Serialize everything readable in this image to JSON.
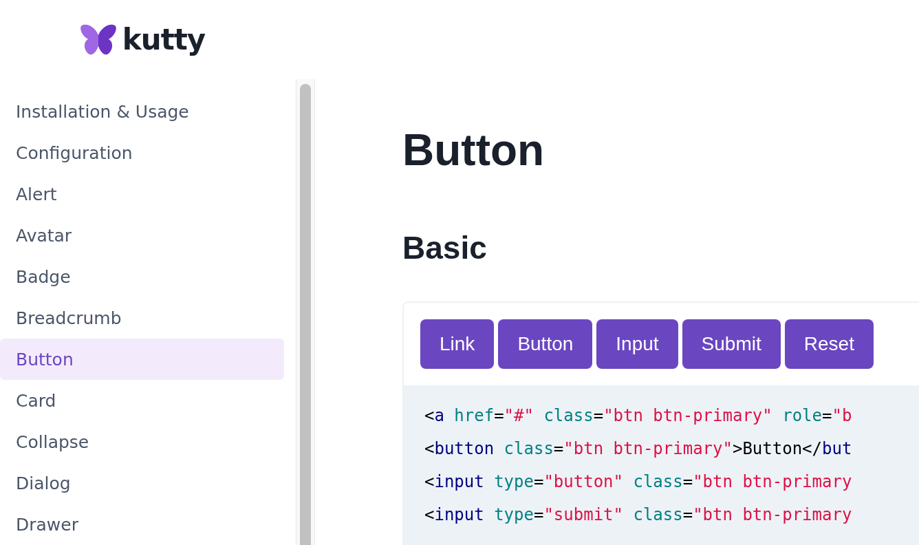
{
  "logo": {
    "name": "kutty"
  },
  "sidebar": {
    "items": [
      {
        "label": "Installation & Usage",
        "selected": false
      },
      {
        "label": "Configuration",
        "selected": false
      },
      {
        "label": "Alert",
        "selected": false
      },
      {
        "label": "Avatar",
        "selected": false
      },
      {
        "label": "Badge",
        "selected": false
      },
      {
        "label": "Breadcrumb",
        "selected": false
      },
      {
        "label": "Button",
        "selected": true
      },
      {
        "label": "Card",
        "selected": false
      },
      {
        "label": "Collapse",
        "selected": false
      },
      {
        "label": "Dialog",
        "selected": false
      },
      {
        "label": "Drawer",
        "selected": false
      }
    ]
  },
  "page": {
    "title": "Button",
    "section": "Basic"
  },
  "example": {
    "buttons": [
      "Link",
      "Button",
      "Input",
      "Submit",
      "Reset"
    ],
    "code_lines": [
      [
        {
          "kind": "punct",
          "text": "<"
        },
        {
          "kind": "tag",
          "text": "a"
        },
        {
          "kind": "attr",
          "text": " href"
        },
        {
          "kind": "punct",
          "text": "="
        },
        {
          "kind": "string",
          "text": "\"#\""
        },
        {
          "kind": "attr",
          "text": " class"
        },
        {
          "kind": "punct",
          "text": "="
        },
        {
          "kind": "string",
          "text": "\"btn btn-primary\""
        },
        {
          "kind": "attr",
          "text": " role"
        },
        {
          "kind": "punct",
          "text": "="
        },
        {
          "kind": "string",
          "text": "\"b"
        }
      ],
      [
        {
          "kind": "punct",
          "text": "<"
        },
        {
          "kind": "tag",
          "text": "button"
        },
        {
          "kind": "attr",
          "text": " class"
        },
        {
          "kind": "punct",
          "text": "="
        },
        {
          "kind": "string",
          "text": "\"btn btn-primary\""
        },
        {
          "kind": "punct",
          "text": ">Button</"
        },
        {
          "kind": "tag",
          "text": "but"
        }
      ],
      [
        {
          "kind": "punct",
          "text": "<"
        },
        {
          "kind": "tag",
          "text": "input"
        },
        {
          "kind": "attr",
          "text": " type"
        },
        {
          "kind": "punct",
          "text": "="
        },
        {
          "kind": "string",
          "text": "\"button\""
        },
        {
          "kind": "attr",
          "text": " class"
        },
        {
          "kind": "punct",
          "text": "="
        },
        {
          "kind": "string",
          "text": "\"btn btn-primary"
        }
      ],
      [
        {
          "kind": "punct",
          "text": "<"
        },
        {
          "kind": "tag",
          "text": "input"
        },
        {
          "kind": "attr",
          "text": " type"
        },
        {
          "kind": "punct",
          "text": "="
        },
        {
          "kind": "string",
          "text": "\"submit\""
        },
        {
          "kind": "attr",
          "text": " class"
        },
        {
          "kind": "punct",
          "text": "="
        },
        {
          "kind": "string",
          "text": "\"btn btn-primary"
        }
      ]
    ]
  }
}
